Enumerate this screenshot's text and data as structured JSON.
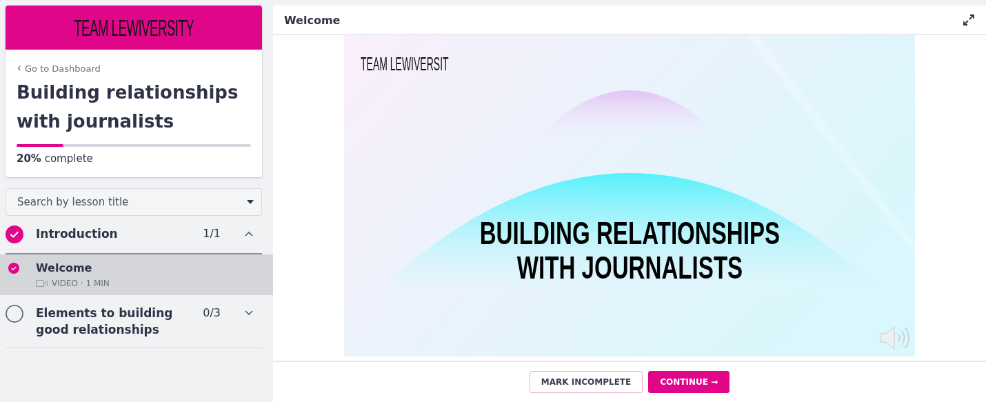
{
  "sidebar": {
    "logo": "TEAM LEWIVERSITY",
    "back_link": "Go to Dashboard",
    "course_title": "Building relationships with journalists",
    "progress": {
      "level": 0.2,
      "text": "**20%** complete"
    },
    "search": {
      "placeholder": "Search by lesson title"
    },
    "sections": [
      {
        "title": "Introduction",
        "count": "1/1",
        "checked": true,
        "expanded": true,
        "lessons": [
          {
            "title": "Welcome",
            "meta": "VIDEO · 1 MIN",
            "checked": true,
            "selected": true
          }
        ]
      },
      {
        "title": "Elements to building good relationships",
        "count": "0/3",
        "checked": false,
        "expanded": false
      }
    ]
  },
  "lesson": {
    "title": "Welcome",
    "slide": {
      "logo": "TEAM LEWIVERSIT",
      "headline": [
        "BUILDING RELATIONSHIPS",
        "WITH JOURNALISTS"
      ]
    },
    "buttons": [
      {
        "label": "MARK INCOMPLETE",
        "kind": "outline"
      },
      {
        "label": "CONTINUE →",
        "kind": "primary"
      }
    ]
  }
}
